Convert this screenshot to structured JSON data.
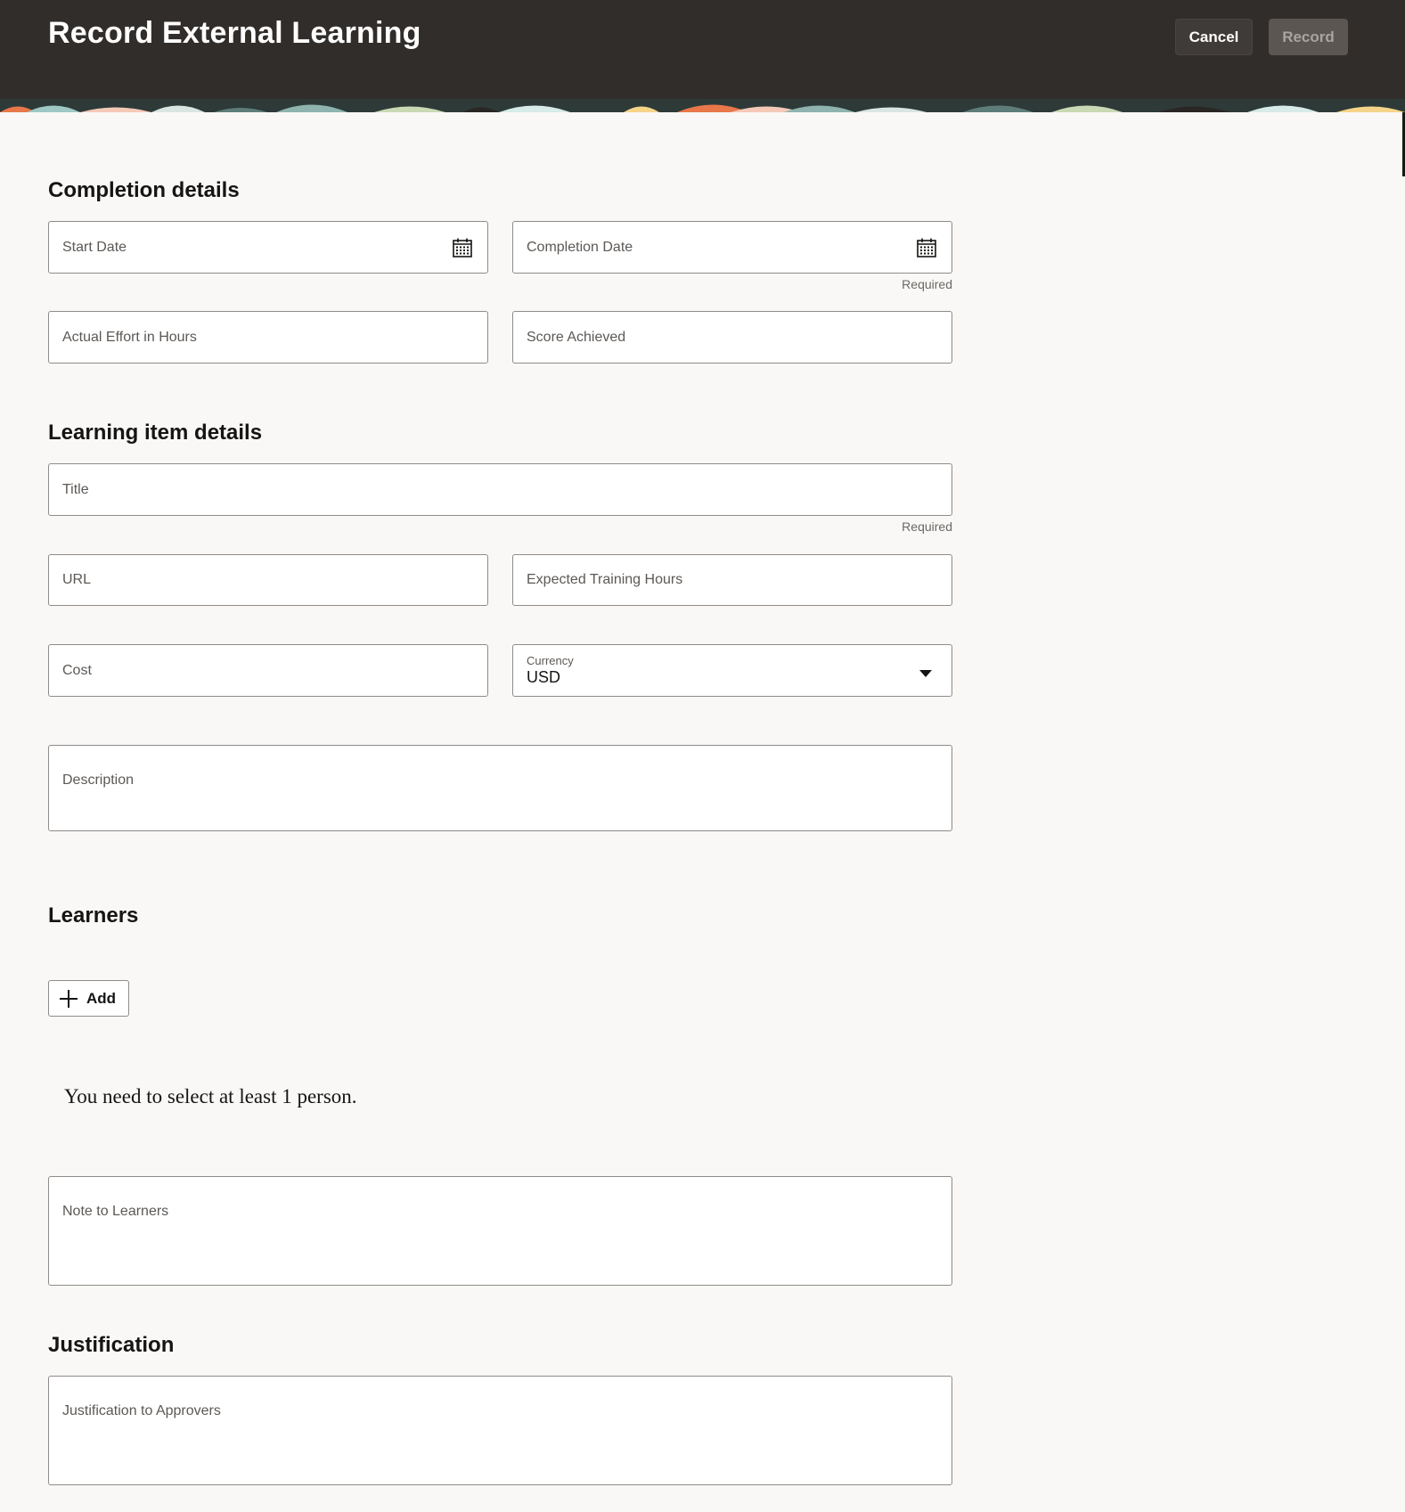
{
  "header": {
    "title": "Record External Learning",
    "cancel_label": "Cancel",
    "record_label": "Record"
  },
  "completion": {
    "title": "Completion details",
    "start_date": "Start Date",
    "completion_date": "Completion Date",
    "completion_required": "Required",
    "actual_effort": "Actual Effort in Hours",
    "score_achieved": "Score Achieved"
  },
  "learning_item": {
    "title": "Learning item details",
    "title_field": "Title",
    "title_required": "Required",
    "url": "URL",
    "expected_hours": "Expected Training Hours",
    "cost": "Cost",
    "currency_label": "Currency",
    "currency_value": "USD",
    "description": "Description"
  },
  "learners": {
    "title": "Learners",
    "add_label": "Add",
    "empty_message": "You need to select at least 1 person.",
    "note": "Note to Learners"
  },
  "justification": {
    "title": "Justification",
    "field": "Justification to Approvers"
  },
  "colors": {
    "header_bg": "#312d2a",
    "page_bg": "#f9f8f6",
    "field_border": "#8f8b88"
  }
}
